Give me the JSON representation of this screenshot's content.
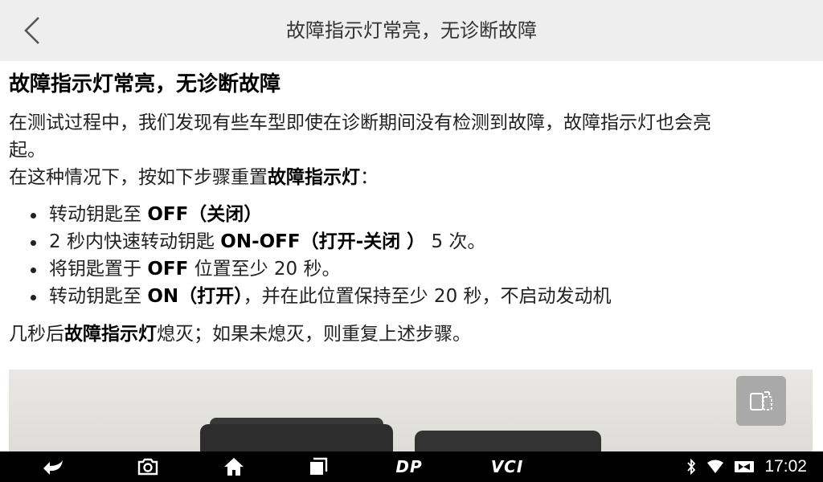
{
  "header": {
    "title": "故障指示灯常亮，无诊断故障"
  },
  "article": {
    "title": "故障指示灯常亮，无诊断故障",
    "intro_line1": "在测试过程中，我们发现有些车型即使在诊断期间没有检测到故障，故障指示灯也会亮",
    "intro_line2": "起。",
    "reset_prefix": "在这种情况下，按如下步骤重置",
    "reset_bold": "故障指示灯",
    "reset_suffix": "：",
    "steps": [
      {
        "pre": "转动钥匙至 ",
        "bold": "OFF（关闭）",
        "post": ""
      },
      {
        "pre": "2 秒内快速转动钥匙 ",
        "bold": "ON-OFF（打开-关闭 ）",
        "post": " 5 次。"
      },
      {
        "pre": "将钥匙置于 ",
        "bold": "OFF",
        "post": " 位置至少 20 秒。"
      },
      {
        "pre": "转动钥匙至 ",
        "bold": "ON（打开）",
        "post": "，并在此位置保持至少 20 秒，不启动发动机"
      }
    ],
    "after_prefix": "几秒后",
    "after_bold": "故障指示灯",
    "after_suffix": "熄灭；如果未熄灭，则重复上述步骤。"
  },
  "navbar": {
    "dp_label": "DP",
    "vci_label": "VCI"
  },
  "status": {
    "time": "17:02"
  }
}
